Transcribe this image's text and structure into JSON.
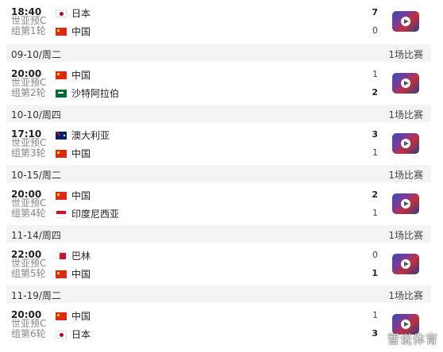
{
  "matches": [
    {
      "time": "18:40",
      "comp1": "世亚预C",
      "comp2": "组第1轮",
      "team1": "日本",
      "team2": "中国",
      "flag1": "jp-flag-icon",
      "flag2": "cn-flag-icon",
      "score1": "7",
      "score2": "0"
    },
    {
      "time": "20:00",
      "comp1": "世亚预C",
      "comp2": "组第2轮",
      "team1": "中国",
      "team2": "沙特阿拉伯",
      "flag1": "cn-flag-icon",
      "flag2": "sa-flag-icon",
      "score1": "1",
      "score2": "2"
    },
    {
      "time": "17:10",
      "comp1": "世亚预C",
      "comp2": "组第3轮",
      "team1": "澳大利亚",
      "team2": "中国",
      "flag1": "au-flag-icon",
      "flag2": "cn-flag-icon",
      "score1": "3",
      "score2": "1"
    },
    {
      "time": "20:00",
      "comp1": "世亚预C",
      "comp2": "组第4轮",
      "team1": "中国",
      "team2": "印度尼西亚",
      "flag1": "cn-flag-icon",
      "flag2": "id-flag-icon",
      "score1": "2",
      "score2": "1"
    },
    {
      "time": "22:00",
      "comp1": "世亚预C",
      "comp2": "组第5轮",
      "team1": "巴林",
      "team2": "中国",
      "flag1": "bh-flag-icon",
      "flag2": "cn-flag-icon",
      "score1": "0",
      "score2": "1"
    },
    {
      "time": "20:00",
      "comp1": "世亚预C",
      "comp2": "组第6轮",
      "team1": "中国",
      "team2": "日本",
      "flag1": "cn-flag-icon",
      "flag2": "jp-flag-icon",
      "score1": "1",
      "score2": "3"
    }
  ],
  "dates": [
    {
      "date": "09-10/周二",
      "count": "1场比赛"
    },
    {
      "date": "10-10/周四",
      "count": "1场比赛"
    },
    {
      "date": "10-15/周二",
      "count": "1场比赛"
    },
    {
      "date": "11-14/周四",
      "count": "1场比赛"
    },
    {
      "date": "11-19/周二",
      "count": "1场比赛"
    }
  ],
  "watermark": "暂说体育"
}
